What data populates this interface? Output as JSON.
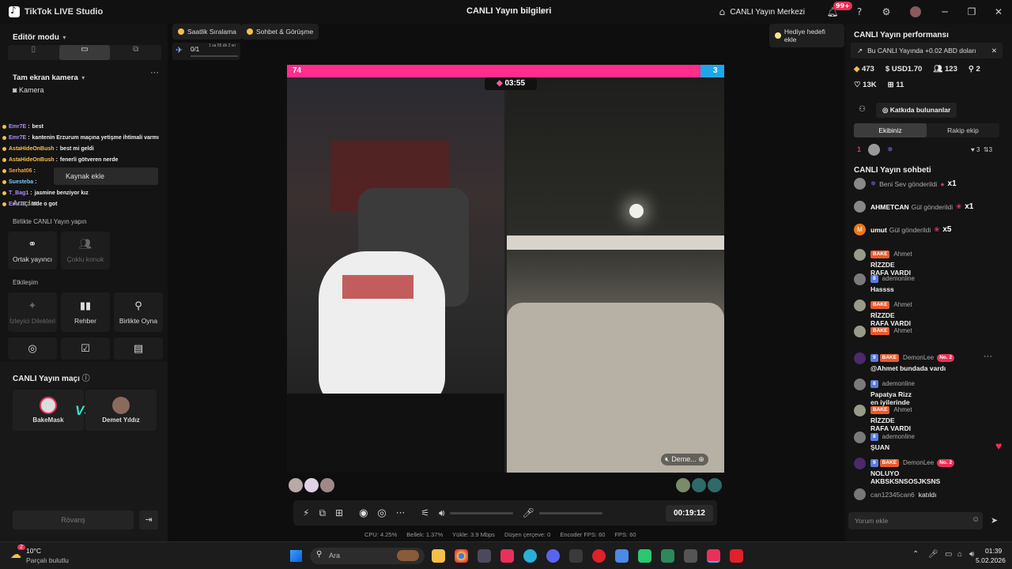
{
  "window": {
    "app_title": "TikTok LIVE Studio",
    "center_title": "CANLI Yayın bilgileri",
    "live_center": "CANLI Yayın Merkezi",
    "notif_badge": "99+"
  },
  "left": {
    "editor_mode": "Editör modu",
    "scene": "Tam ekran kamera",
    "camera_source": "Kamera",
    "add_source": "Kaynak ekle",
    "tools_header": "Araçlar",
    "collab_header": "Birlikte CANLI Yayın yapın",
    "cohost": "Ortak yayıncı",
    "multi_guest": "Çoklu konuk",
    "interaction_header": "Etkileşim",
    "viewer_wishes": "İzleyici Dilekleri",
    "guide": "Rehber",
    "play_together": "Birlikte Oyna",
    "match_header": "CANLI Yayın maçı",
    "player1": "BakeMask",
    "player2": "Demet Yıldız",
    "rematch": "Rövanş",
    "chat": [
      {
        "name": "Emr7E",
        "text": "best",
        "color": "#b08cff"
      },
      {
        "name": "Emr7E",
        "text": "kantenin Erzurum maçına yetişme ihtimali varmı",
        "color": "#b08cff"
      },
      {
        "name": "AstaHideOnBush",
        "text": "best mi geldi",
        "color": "#f5c04a"
      },
      {
        "name": "AstaHideOnBush",
        "text": "fenerli götveren nerde",
        "color": "#f5c04a"
      },
      {
        "name": "Serhat06",
        "text": "",
        "color": "#f5a04a"
      },
      {
        "name": "Suesteba",
        "text": "",
        "color": "#7fc8ff"
      },
      {
        "name": "T_Bag1",
        "text": "jasmine benziyor kız",
        "color": "#b08cff"
      },
      {
        "name": "Emr7E",
        "text": "ttde o got",
        "color": "#b08cff"
      }
    ]
  },
  "center": {
    "hourly_rank": "Saatlik Sıralama",
    "chat_meet": "Sohbet & Görüşme",
    "gift_goal": "Hediye hedefi ekle",
    "goal_progress": "0/1",
    "goal_timer": "1 sa 55 dk 2 sn",
    "battle_left_score": "74",
    "battle_right_score": "3",
    "battle_timer": "03:55",
    "opponent_name": "Deme...",
    "stream_time": "00:19:12",
    "stats": {
      "cpu": "CPU: 4.25%",
      "mem": "Bellek: 1.37%",
      "upload": "Yükle: 3.9 Mbps",
      "dropped": "Düşen çerçeve: 0",
      "enc_fps": "Encoder FPS: 60",
      "fps": "FPS: 60"
    }
  },
  "right": {
    "perf_title": "CANLI Yayın performansı",
    "earning_note": "Bu CANLI Yayında +0.02 ABD doları",
    "diamonds": "473",
    "usd": "USD1.70",
    "viewers": "123",
    "shares": "2",
    "likes": "13K",
    "gifts": "11",
    "contributors": "Katkıda bulunanlar",
    "tab_mine": "Ekibiniz",
    "tab_rival": "Rakip ekip",
    "rank1": "1",
    "rank1_a": "3",
    "rank1_b": "3",
    "chat_title": "CANLI Yayın sohbeti",
    "gifts_feed": [
      {
        "user": "",
        "action": "Beni Sev gönderildi",
        "count": "x1"
      },
      {
        "user": "AHMETCAN",
        "action": "Gül gönderildi",
        "count": "x1"
      },
      {
        "user": "umut",
        "action": "Gül gönderildi",
        "count": "x5"
      }
    ],
    "messages": [
      {
        "tags": [
          "BAKE"
        ],
        "who": "Ahmet",
        "text": "RİZZDE RAFA VARDI"
      },
      {
        "tags": [
          "8"
        ],
        "who": "ademonline",
        "text": "Hassss"
      },
      {
        "tags": [
          "BAKE"
        ],
        "who": "Ahmet",
        "text": "RİZZDE RAFA VARDI"
      },
      {
        "tags": [
          "BAKE"
        ],
        "who": "Ahmet",
        "text": ""
      },
      {
        "tags": [
          "9",
          "BAKE"
        ],
        "who": "DemonLee",
        "rank": "No. 2",
        "text": "@Ahmet bundada vardı"
      },
      {
        "tags": [
          "8"
        ],
        "who": "ademonline",
        "text": "Papatya Rizz en iyilerinde"
      },
      {
        "tags": [
          "BAKE"
        ],
        "who": "Ahmet",
        "text": "RİZZDE RAFA VARDI"
      },
      {
        "tags": [
          "8"
        ],
        "who": "ademonline",
        "text": "ŞUAN"
      },
      {
        "tags": [
          "9",
          "BAKE"
        ],
        "who": "DemonLee",
        "rank": "No. 2",
        "text": "NOLUYO AKBSKSNSOSJKSNS"
      }
    ],
    "join_user": "can12345can6",
    "join_text": "katıldı",
    "comment_placeholder": "Yorum ekle"
  },
  "taskbar": {
    "temp": "10°C",
    "weather": "Parçalı bulutlu",
    "search": "Ara",
    "time": "01:39",
    "date": "5.02.2026",
    "weather_badge": "2"
  }
}
